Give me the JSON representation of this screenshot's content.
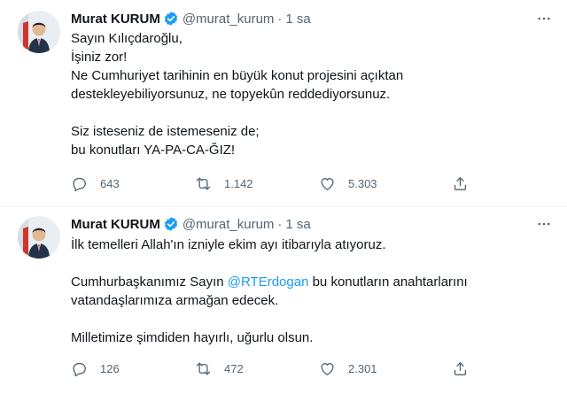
{
  "tweets": [
    {
      "author": {
        "name": "Murat KURUM",
        "handle": "@murat_kurum"
      },
      "separator": "·",
      "time": "1 sa",
      "lines": [
        "Sayın Kılıçdaroğlu,",
        "İşiniz zor!",
        "Ne Cumhuriyet tarihinin en büyük konut projesini açıktan",
        "destekleyebiliyorsunuz, ne topyekûn reddediyorsunuz.",
        "",
        "Siz isteseniz de istemeseniz de;",
        "bu konutları YA-PA-CA-ĞIZ!"
      ],
      "counts": {
        "replies": "643",
        "retweets": "1.142",
        "likes": "5.303"
      }
    },
    {
      "author": {
        "name": "Murat KURUM",
        "handle": "@murat_kurum"
      },
      "separator": "·",
      "time": "1 sa",
      "line1": "İlk temelleri Allah'ın izniyle ekim ayı itibarıyla atıyoruz.",
      "line2_before": "Cumhurbaşkanımız Sayın ",
      "line2_mention": "@RTErdogan",
      "line2_after": " bu konutların anahtarlarını",
      "line3": "vatandaşlarımıza armağan edecek.",
      "line4": "Milletimize şimdiden hayırlı, uğurlu olsun.",
      "counts": {
        "replies": "126",
        "retweets": "472",
        "likes": "2.301"
      }
    }
  ],
  "colors": {
    "text": "#0f1419",
    "secondary": "#536471",
    "accent": "#1d9bf0",
    "divider": "#eff3f4"
  },
  "icons": [
    "verified-badge-icon",
    "more-options-icon",
    "reply-icon",
    "retweet-icon",
    "like-icon",
    "share-icon"
  ]
}
